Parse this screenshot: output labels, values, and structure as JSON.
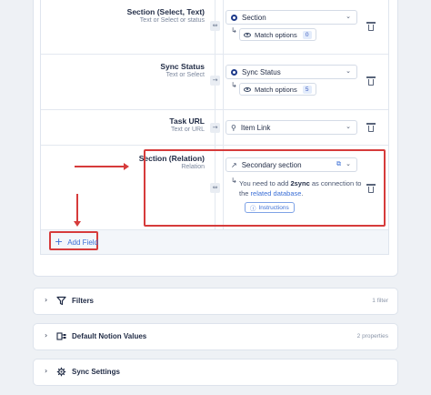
{
  "mapping_rows": [
    {
      "source_title": "Section (Select, Text)",
      "source_sub": "Text or Select or status",
      "target_label": "Section",
      "target_icon": "select-dot-icon",
      "match_label": "Match options",
      "match_count": "0"
    },
    {
      "source_title": "Sync Status",
      "source_sub": "Text or Select",
      "target_label": "Sync Status",
      "target_icon": "select-dot-icon",
      "match_label": "Match options",
      "match_count": "5"
    },
    {
      "source_title": "Task URL",
      "source_sub": "Text or URL",
      "target_label": "Item Link",
      "target_icon": "link-icon"
    },
    {
      "source_title": "Section (Relation)",
      "source_sub": "Relation",
      "target_label": "Secondary section",
      "target_icon": "relation-arrow-icon",
      "info_pre": "You need to add",
      "info_bold": "2sync",
      "info_mid": "as connection to the",
      "info_link": "related database",
      "info_end": ".",
      "instructions_label": "Instructions"
    }
  ],
  "add_field_label": "Add Field",
  "sections": [
    {
      "title": "Filters",
      "meta": "1 filter",
      "icon": "filter-icon"
    },
    {
      "title": "Default Notion Values",
      "meta": "2 properties",
      "icon": "default-values-icon"
    },
    {
      "title": "Sync Settings",
      "meta": "",
      "icon": "settings-gear-icon"
    }
  ],
  "colors": {
    "accent": "#3b6fd6",
    "highlight": "#d63b3b",
    "page_bg": "#eef1f5"
  }
}
